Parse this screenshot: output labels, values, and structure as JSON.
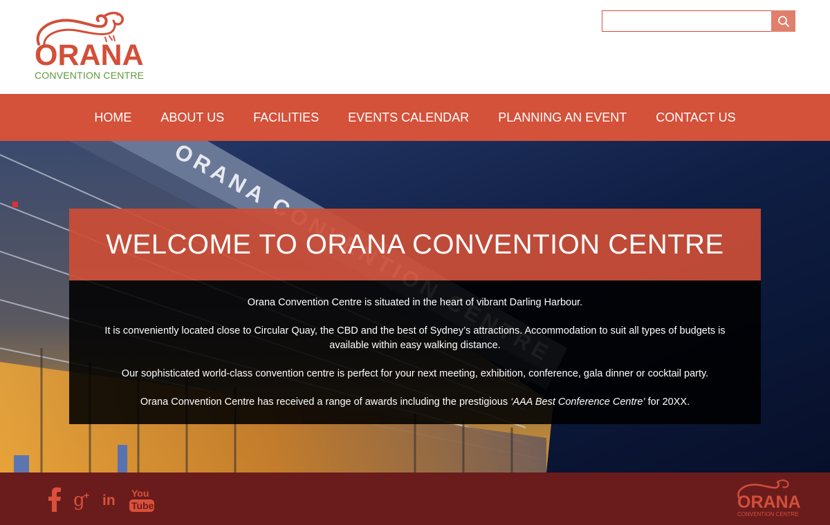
{
  "brand": {
    "name": "ORANA",
    "subtitle": "CONVENTION CENTRE"
  },
  "search": {
    "placeholder": "",
    "value": ""
  },
  "nav": {
    "items": [
      {
        "label": "HOME"
      },
      {
        "label": "ABOUT US"
      },
      {
        "label": "FACILITIES"
      },
      {
        "label": "EVENTS CALENDAR"
      },
      {
        "label": "PLANNING AN EVENT"
      },
      {
        "label": "CONTACT US"
      }
    ]
  },
  "hero": {
    "title": "WELCOME TO ORANA CONVENTION CENTRE",
    "paragraphs": {
      "p1": "Orana Convention Centre is situated in the heart of vibrant Darling Harbour.",
      "p2": "It is conveniently located close to Circular Quay, the CBD and the best of Sydney’s attractions. Accommodation to suit all types of budgets is available within easy walking distance.",
      "p3": "Our sophisticated world-class convention centre is perfect for your next meeting, exhibition, conference, gala dinner or cocktail party.",
      "p4_before": "Orana Convention Centre has received a range of awards including the prestigious ",
      "p4_award": "‘AAA Best Conference Centre’",
      "p4_after": " for 20XX."
    },
    "building_sign": "ORANA CONVENTION CENTRE"
  },
  "footer": {
    "social": [
      {
        "icon": "facebook-icon"
      },
      {
        "icon": "google-plus-icon"
      },
      {
        "icon": "linkedin-icon"
      },
      {
        "icon": "youtube-icon"
      }
    ],
    "logo_name": "ORANA",
    "logo_subtitle": "CONVENTION CENTRE"
  },
  "colors": {
    "brand_orange": "#d4513a",
    "brand_green": "#5a9a3c",
    "footer_bg": "#6a1c1c",
    "search_button": "#e07f6c"
  }
}
